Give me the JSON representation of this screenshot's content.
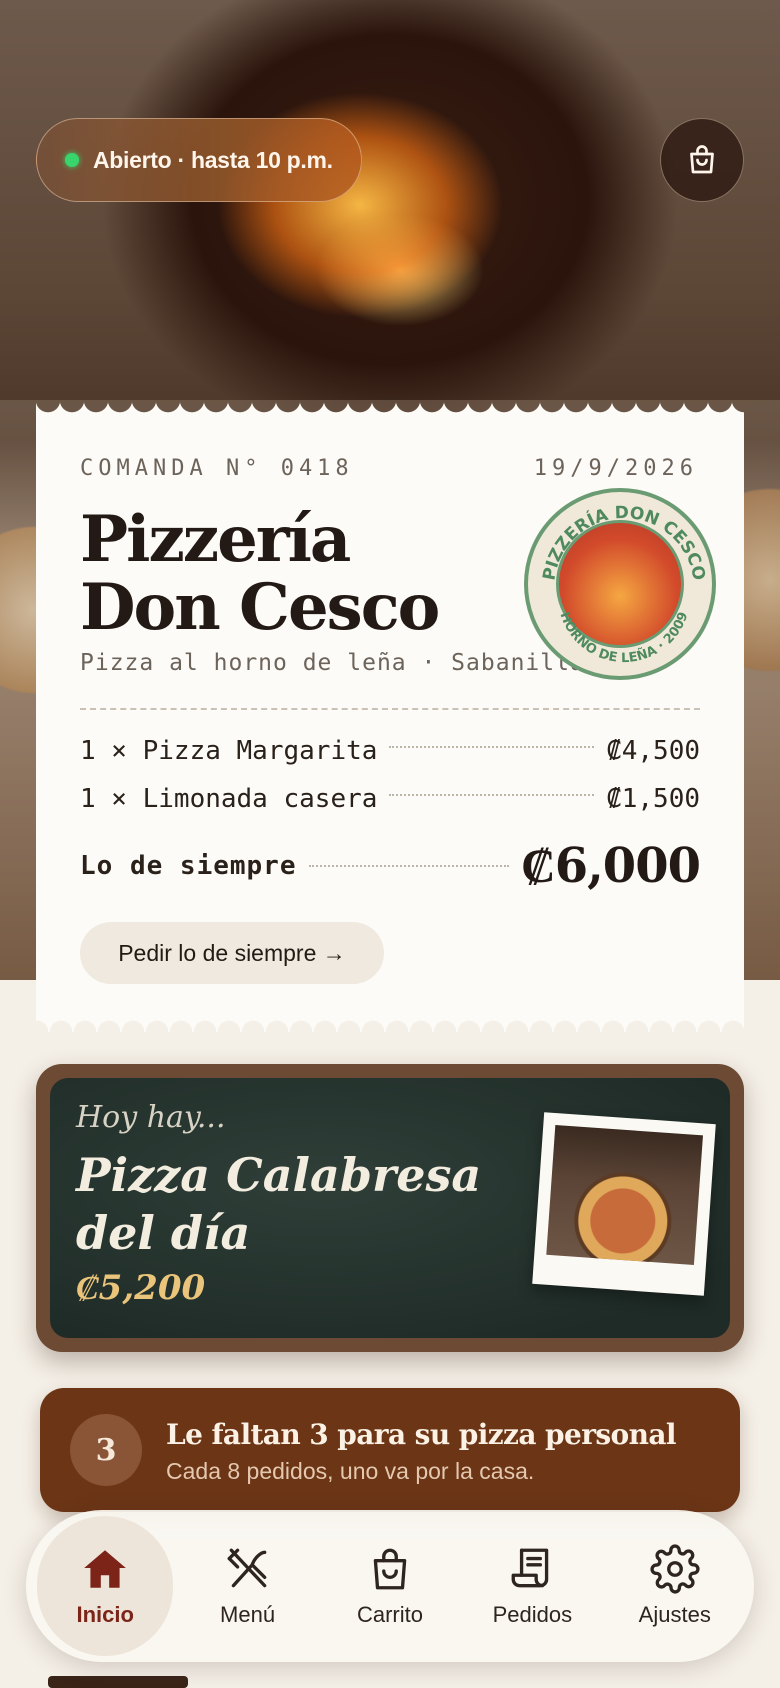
{
  "header": {
    "status_text": "Abierto · hasta 10 p.m.",
    "status_color": "#39d46b",
    "cart_icon": "shopping-bag-icon"
  },
  "receipt": {
    "order_number": "COMANDA N° 0418",
    "date": "19/9/2026",
    "restaurant_name_line1": "Pizzería",
    "restaurant_name_line2": "Don Cesco",
    "tagline": "Pizza al horno de leña · Sabanilla",
    "seal_text_top": "PIZZERÍA DON CESCO",
    "seal_text_bottom": "HORNO DE LEÑA · 2009",
    "items": [
      {
        "label": "1 × Pizza Margarita",
        "price": "₡4,500"
      },
      {
        "label": "1 × Limonada casera",
        "price": "₡1,500"
      }
    ],
    "total_label": "Lo de siempre",
    "total_value": "₡6,000",
    "reorder_button": "Pedir lo de siempre →"
  },
  "special": {
    "kicker": "Hoy hay...",
    "name": "Pizza Calabresa del día",
    "price": "₡5,200"
  },
  "loyalty": {
    "remaining": "3",
    "title": "Le faltan 3 para su pizza personal",
    "subtitle": "Cada 8 pedidos, uno va por la casa."
  },
  "nav": {
    "items": [
      {
        "label": "Inicio",
        "icon": "home-icon",
        "active": true
      },
      {
        "label": "Menú",
        "icon": "fork-knife-icon",
        "active": false
      },
      {
        "label": "Carrito",
        "icon": "shopping-bag-icon",
        "active": false
      },
      {
        "label": "Pedidos",
        "icon": "receipt-icon",
        "active": false
      },
      {
        "label": "Ajustes",
        "icon": "gear-icon",
        "active": false
      }
    ]
  },
  "colors": {
    "accent": "#7b2417",
    "loyalty_bg": "#6b3516",
    "board_frame": "#6d4a33",
    "chalk_price": "#e9c47a"
  }
}
